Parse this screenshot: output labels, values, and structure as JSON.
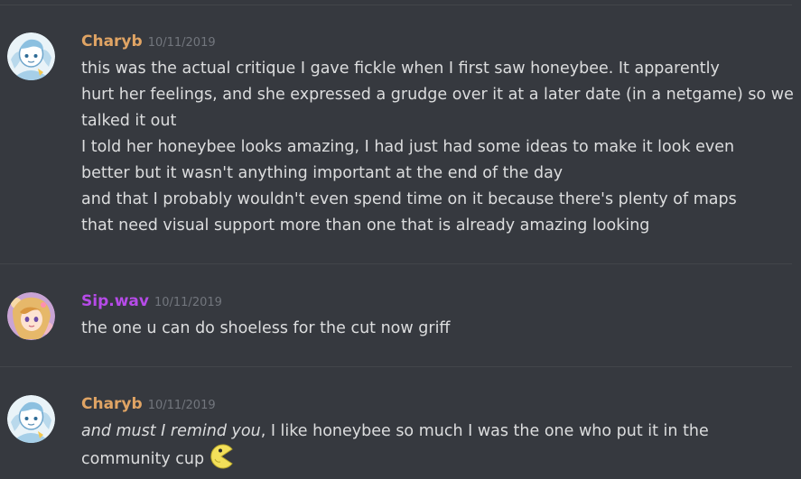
{
  "colors": {
    "background": "#36393f",
    "text": "#dcddde",
    "timestamp": "#72767d",
    "divider": "#42454a",
    "charyb_name": "#e0a464",
    "sip_name": "#b64be8"
  },
  "messages": [
    {
      "author": "Charyb",
      "timestamp": "10/11/2019",
      "avatar_icon": "ice-character-avatar",
      "lines": [
        "this was the actual critique I gave fickle when I first saw honeybee. It apparently",
        "hurt her feelings, and she expressed a grudge over it at a later date (in a netgame) so we",
        "talked it out",
        "I told her honeybee looks amazing, I had just had some ideas to make it look even",
        "better but it wasn't anything important at the end of the day",
        "and that I probably wouldn't even spend time on it because there's plenty of maps",
        "that need visual support more than one that is already amazing looking"
      ]
    },
    {
      "author": "Sip.wav",
      "timestamp": "10/11/2019",
      "avatar_icon": "anime-girl-avatar",
      "lines": [
        "the one u can do shoeless for the cut now griff"
      ]
    },
    {
      "author": "Charyb",
      "timestamp": "10/11/2019",
      "avatar_icon": "ice-character-avatar",
      "lines": [
        {
          "italic": "and must I remind you",
          "rest": ", I like honeybee so much I was the one who put it in the"
        },
        "community cup"
      ],
      "emoji": "pacman-emoji"
    }
  ]
}
